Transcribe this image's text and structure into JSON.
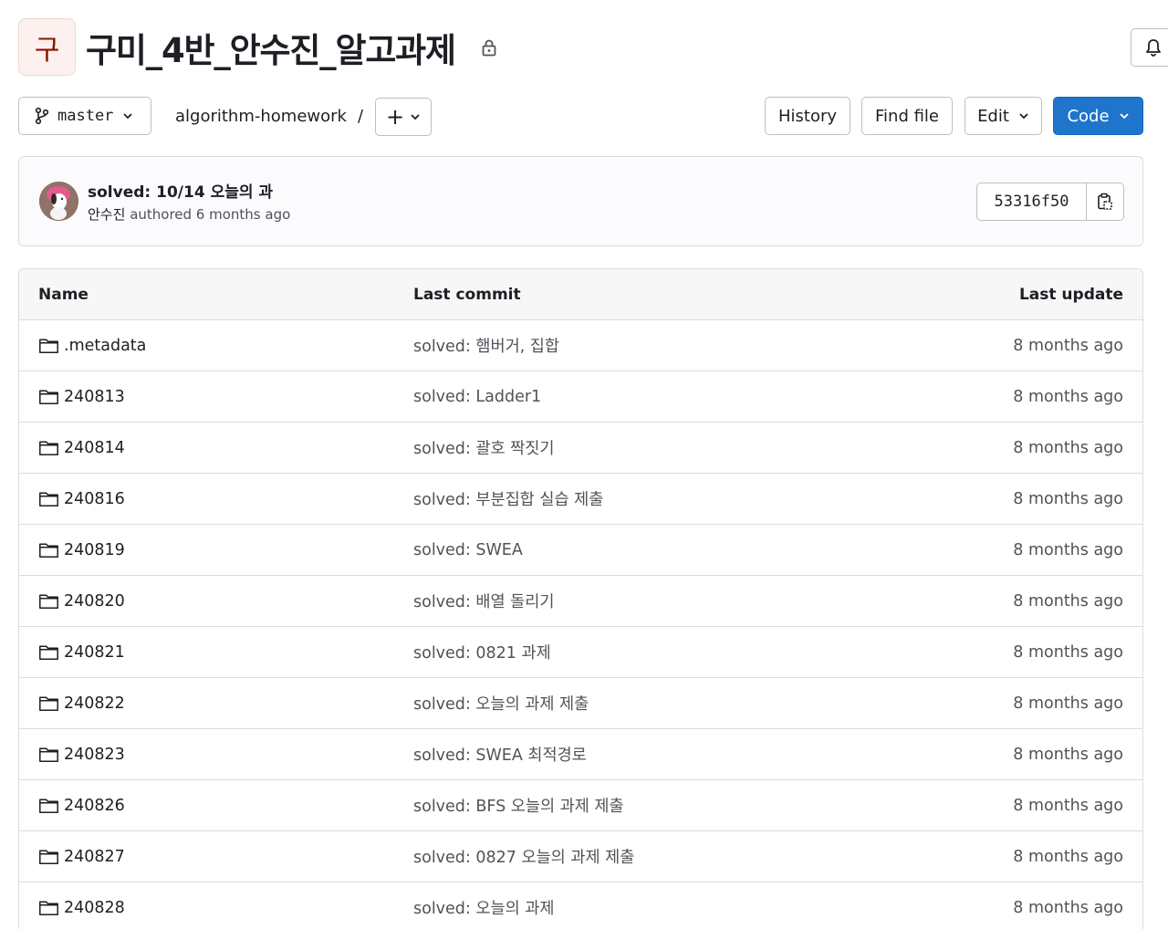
{
  "project": {
    "avatar_letter": "구",
    "title": "구미_4반_안수진_알고과제"
  },
  "toolbar": {
    "branch": "master",
    "repo_path": "algorithm-homework",
    "path_separator": "/",
    "add_label": "+",
    "history_label": "History",
    "find_file_label": "Find file",
    "edit_label": "Edit",
    "code_label": "Code"
  },
  "commit": {
    "title": "solved: 10/14 오늘의 과",
    "author": "안수진",
    "authored_text": "authored 6 months ago",
    "sha": "53316f50"
  },
  "table": {
    "headers": {
      "name": "Name",
      "last_commit": "Last commit",
      "last_update": "Last update"
    },
    "rows": [
      {
        "name": ".metadata",
        "commit": "solved: 햄버거, 집합",
        "updated": "8 months ago"
      },
      {
        "name": "240813",
        "commit": "solved: Ladder1",
        "updated": "8 months ago"
      },
      {
        "name": "240814",
        "commit": "solved: 괄호 짝짓기",
        "updated": "8 months ago"
      },
      {
        "name": "240816",
        "commit": "solved: 부분집합 실습 제출",
        "updated": "8 months ago"
      },
      {
        "name": "240819",
        "commit": "solved: SWEA",
        "updated": "8 months ago"
      },
      {
        "name": "240820",
        "commit": "solved: 배열 돌리기",
        "updated": "8 months ago"
      },
      {
        "name": "240821",
        "commit": "solved: 0821 과제",
        "updated": "8 months ago"
      },
      {
        "name": "240822",
        "commit": "solved: 오늘의 과제 제출",
        "updated": "8 months ago"
      },
      {
        "name": "240823",
        "commit": "solved: SWEA 최적경로",
        "updated": "8 months ago"
      },
      {
        "name": "240826",
        "commit": "solved: BFS 오늘의 과제 제출",
        "updated": "8 months ago"
      },
      {
        "name": "240827",
        "commit": "solved: 0827 오늘의 과제 제출",
        "updated": "8 months ago"
      },
      {
        "name": "240828",
        "commit": "solved: 오늘의 과제",
        "updated": "8 months ago"
      }
    ]
  },
  "icons": {
    "lock": "lock-icon",
    "bell": "bell-icon",
    "branch": "branch-icon",
    "chevron": "chevron-down-icon",
    "copy": "copy-icon",
    "folder": "folder-icon"
  },
  "colors": {
    "primary": "#1f75cb",
    "avatar_bg": "#fcf1ef",
    "avatar_text": "#8d1300"
  }
}
